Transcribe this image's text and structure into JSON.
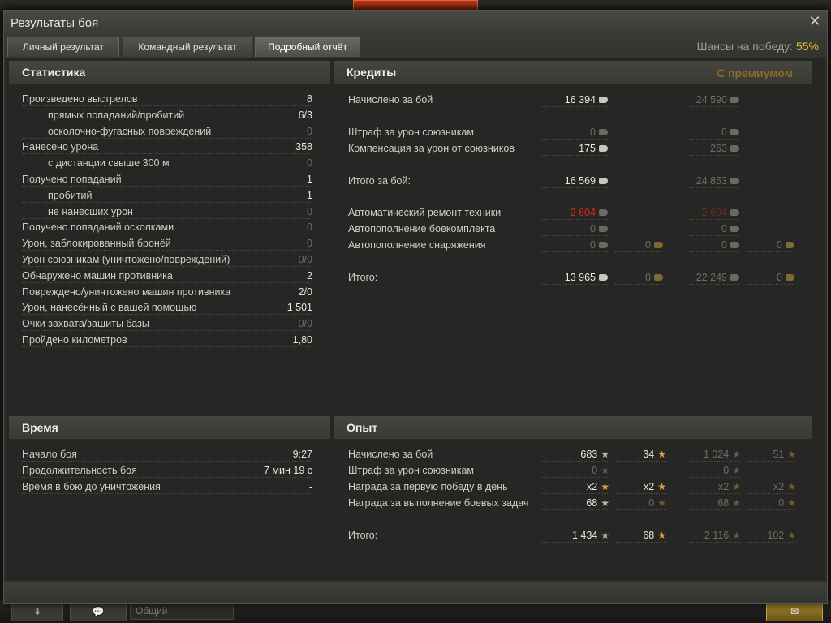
{
  "background": {
    "chat_placeholder": "Общий"
  },
  "window": {
    "title": "Результаты боя",
    "tabs": [
      {
        "label": "Личный результат"
      },
      {
        "label": "Командный результат"
      },
      {
        "label": "Подробный отчёт"
      }
    ],
    "odds_label": "Шансы на победу:",
    "odds_value": "55%"
  },
  "stats": {
    "header": "Статистика",
    "rows": [
      {
        "label": "Произведено выстрелов",
        "value": "8"
      },
      {
        "label": "прямых попаданий/пробитий",
        "value": "6/3"
      },
      {
        "label": "осколочно-фугасных повреждений",
        "value": "0"
      },
      {
        "label": "Нанесено урона",
        "value": "358"
      },
      {
        "label": "с дистанции свыше 300 м",
        "value": "0"
      },
      {
        "label": "Получено попаданий",
        "value": "1"
      },
      {
        "label": "пробитий",
        "value": "1"
      },
      {
        "label": "не нанёсших урон",
        "value": "0"
      },
      {
        "label": "Получено попаданий осколками",
        "value": "0"
      },
      {
        "label": "Урон, заблокированный бронёй",
        "value": "0"
      },
      {
        "label": "Урон союзникам (уничтожено/повреждений)",
        "value": "0/0"
      },
      {
        "label": "Обнаружено машин противника",
        "value": "2"
      },
      {
        "label": "Повреждено/уничтожено машин противника",
        "value": "2/0"
      },
      {
        "label": "Урон, нанесённый с вашей помощью",
        "value": "1 501"
      },
      {
        "label": "Очки захвата/защиты базы",
        "value": "0/0"
      },
      {
        "label": "Пройдено километров",
        "value": "1,80"
      }
    ]
  },
  "credits": {
    "header": "Кредиты",
    "premium_header": "С премиумом",
    "rows": [
      {
        "label": "Начислено за бой",
        "c": "16 394",
        "g": "",
        "pc": "24 590",
        "pg": ""
      },
      {
        "label": "Штраф за урон союзникам",
        "c": "0",
        "g": "",
        "pc": "0",
        "pg": ""
      },
      {
        "label": "Компенсация за урон от союзников",
        "c": "175",
        "g": "",
        "pc": "263",
        "pg": ""
      },
      {
        "label": "Итого за бой:",
        "c": "16 569",
        "g": "",
        "pc": "24 853",
        "pg": ""
      },
      {
        "label": "Автоматический ремонт техники",
        "c": "-2 604",
        "g": "",
        "pc": "-2 604",
        "pg": ""
      },
      {
        "label": "Автопополнение боекомплекта",
        "c": "0",
        "g": "",
        "pc": "0",
        "pg": ""
      },
      {
        "label": "Автопополнение снаряжения",
        "c": "0",
        "g": "0",
        "pc": "0",
        "pg": "0"
      },
      {
        "label": "Итого:",
        "c": "13 965",
        "g": "0",
        "pc": "22 249",
        "pg": "0"
      }
    ]
  },
  "time": {
    "header": "Время",
    "rows": [
      {
        "label": "Начало боя",
        "value": "9:27"
      },
      {
        "label": "Продолжительность боя",
        "value": "7 мин 19 с"
      },
      {
        "label": "Время в бою до уничтожения",
        "value": "-"
      }
    ]
  },
  "exp": {
    "header": "Опыт",
    "rows": [
      {
        "label": "Начислено за бой",
        "xp": "683",
        "fxp": "34",
        "pxp": "1 024",
        "pfxp": "51"
      },
      {
        "label": "Штраф за урон союзникам",
        "xp": "0",
        "fxp": "",
        "pxp": "0",
        "pfxp": ""
      },
      {
        "label": "Награда за первую победу в день",
        "xp": "x2",
        "fxp": "x2",
        "pxp": "x2",
        "pfxp": "x2"
      },
      {
        "label": "Награда за выполнение боевых задач",
        "xp": "68",
        "fxp": "0",
        "pxp": "68",
        "pfxp": "0"
      },
      {
        "label": "Итого:",
        "xp": "1 434",
        "fxp": "68",
        "pxp": "2 116",
        "pfxp": "102"
      }
    ]
  },
  "colors": {
    "accent_gold": "#e9c02c",
    "negative_red": "#d8261c",
    "panel_header": "#46453f"
  },
  "icons": [
    "close-icon",
    "credit-icon",
    "gold-icon",
    "xp-star-icon",
    "free-xp-star-icon"
  ]
}
